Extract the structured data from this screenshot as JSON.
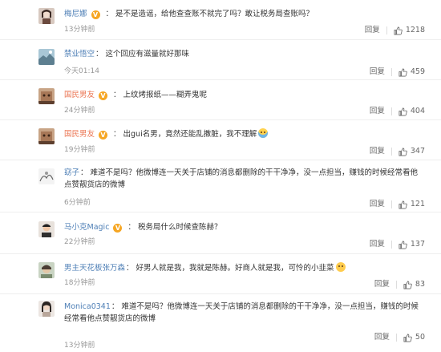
{
  "reply_label": "回复",
  "comments": [
    {
      "user": "梅尼娜",
      "verified": true,
      "text": "是不是造谣，给他查查账不就完了吗？敢让税务局查账吗？",
      "time": "13分钟前",
      "likes": "1218"
    },
    {
      "user": "禁业悟空",
      "verified": false,
      "text": "这个回应有滋量就好那味",
      "time": "今天01:14",
      "likes": "459"
    },
    {
      "user": "国民男友",
      "verified": true,
      "text": "上纹烤报纸——糊弄鬼呢",
      "time": "24分钟前",
      "likes": "404"
    },
    {
      "user": "国民男友",
      "verified": true,
      "text": "出gui名男，竟然还能乱撒脏，我不理解",
      "time": "19分钟前",
      "likes": "347"
    },
    {
      "user": "窈子",
      "verified": false,
      "text": "难道不是吗？他微博连一天关于店铺的消息都删除的干干净净，没一点担当，赚钱的时候经常看他点赞靓货店的微博",
      "time": "6分钟前",
      "likes": "121"
    },
    {
      "user": "马小克Magic",
      "verified": true,
      "text": "税务局什么时候查陈赫？",
      "time": "22分钟前",
      "likes": "137"
    },
    {
      "user": "男主天花板张万森",
      "verified": false,
      "text": "好男人就是我，我就是陈赫。好商人就是我，可怜的小韭菜",
      "time": "18分钟前",
      "likes": "83"
    },
    {
      "user": "Monica0341",
      "verified": false,
      "text": "难道不是吗？他微博连一天关于店铺的消息都删除的干干净净，没一点担当，赚钱的时候经常看他点赞靓货店的微博",
      "time": "13分钟前",
      "likes": "50"
    }
  ]
}
